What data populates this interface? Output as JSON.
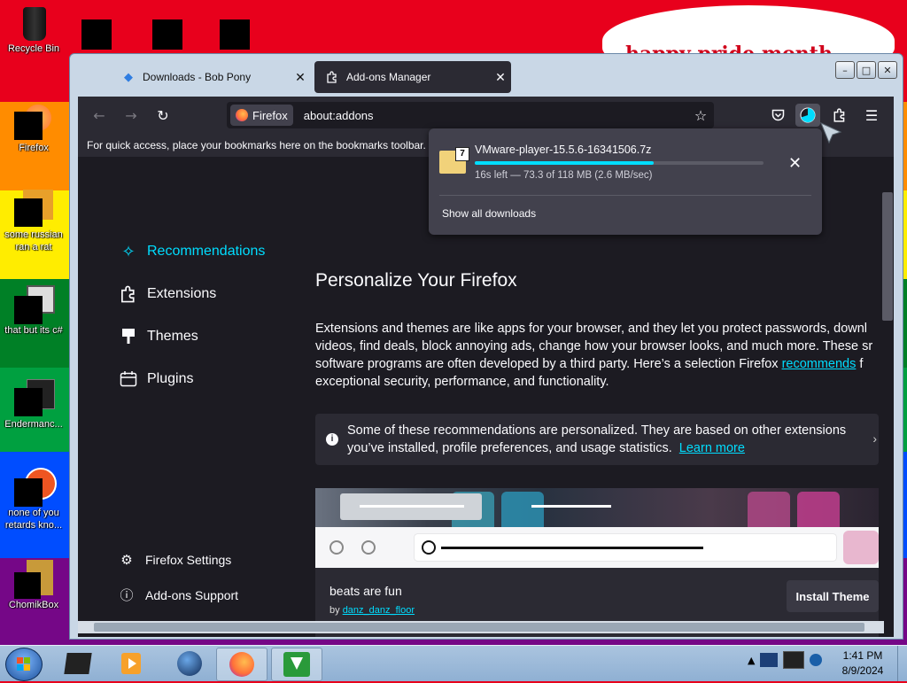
{
  "desktop": {
    "banner_text": "happy pride month",
    "icons": [
      {
        "label": "Recycle Bin",
        "icon": "recycle-bin-icon"
      },
      {
        "label": "Firefox",
        "icon": "firefox-icon"
      },
      {
        "label": "some russian ran a rat",
        "icon": "app-icon"
      },
      {
        "label": "that but its c#",
        "icon": "app-icon"
      },
      {
        "label": "Endermanc...",
        "icon": "app-icon"
      },
      {
        "label": "none of you retards kno...",
        "icon": "app-icon"
      },
      {
        "label": "ChomikBox",
        "icon": "chomikbox-icon"
      }
    ],
    "stripe_colors": [
      "#e8001c",
      "#ff8c00",
      "#ffed00",
      "#008026",
      "#004dff",
      "#750787"
    ]
  },
  "window": {
    "tabs": [
      {
        "label": "Downloads - Bob Pony",
        "icon": "site-icon",
        "close": "✕"
      },
      {
        "label": "Add-ons Manager",
        "icon": "puzzle-icon",
        "close": "✕"
      }
    ],
    "caption": {
      "minimize": "–",
      "maximize": "□",
      "close": "✕"
    }
  },
  "toolbar": {
    "identity_label": "Firefox",
    "url": "about:addons",
    "bookmarks_hint": "For quick access, place your bookmarks here on the bookmarks toolbar. M"
  },
  "downloads": {
    "filename": "VMware-player-15.5.6-16341506.7z",
    "status": "16s left — 73.3 of 118 MB (2.6 MB/sec)",
    "progress_fraction": 0.62,
    "badge": "7",
    "cancel_glyph": "✕",
    "show_all": "Show all downloads"
  },
  "sidebar": {
    "categories": [
      {
        "label": "Recommendations",
        "icon": "sparkle-icon",
        "active": true
      },
      {
        "label": "Extensions",
        "icon": "puzzle-icon",
        "active": false
      },
      {
        "label": "Themes",
        "icon": "brush-icon",
        "active": false
      },
      {
        "label": "Plugins",
        "icon": "plugin-icon",
        "active": false
      }
    ],
    "footer": [
      {
        "label": "Firefox Settings",
        "icon": "gear-icon"
      },
      {
        "label": "Add-ons Support",
        "icon": "help-icon"
      }
    ]
  },
  "main": {
    "title": "Personalize Your Firefox",
    "desc_lines": [
      "Extensions and themes are like apps for your browser, and they let you protect passwords, downl",
      "videos, find deals, block annoying ads, change how your browser looks, and much more. These sr",
      "software programs are often developed by a third party. Here’s a selection Firefox "
    ],
    "desc_link": "recommends",
    "desc_line3_tail": " f",
    "desc_line4": "exceptional security, performance, and functionality.",
    "notice_line1": "Some of these recommendations are personalized. They are based on other extensions",
    "notice_line2": "you’ve installed, profile preferences, and usage statistics.",
    "notice_link": "Learn more",
    "theme_card": {
      "name": "beats are fun",
      "by_prefix": "by ",
      "author": "danz_danz_floor",
      "install_label": "Install Theme"
    }
  },
  "taskbar": {
    "time": "1:41 PM",
    "date": "8/9/2024",
    "tray_arrow": "▲"
  }
}
